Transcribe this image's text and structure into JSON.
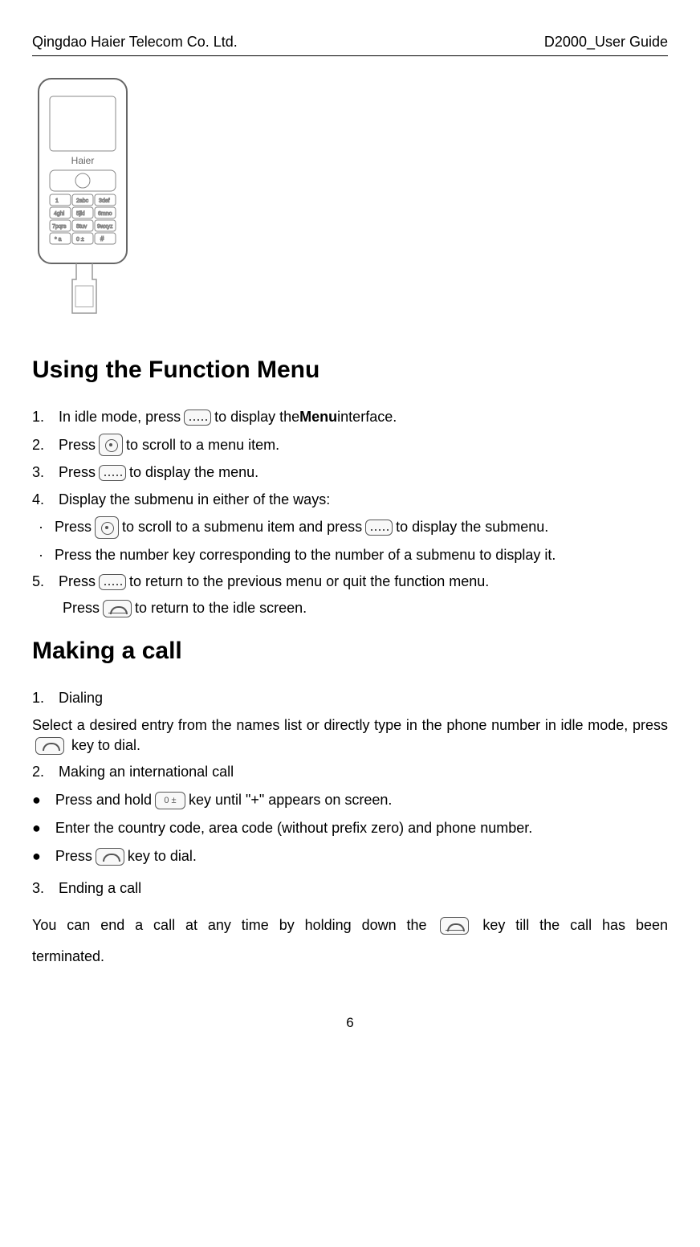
{
  "header": {
    "left": "Qingdao Haier Telecom Co. Ltd.",
    "right": "D2000_User Guide"
  },
  "section1": {
    "title": "Using the Function Menu",
    "items": [
      {
        "num": "1.",
        "pre": "In idle mode, press ",
        "post": " to display the ",
        "bold": "Menu",
        "post2": " interface."
      },
      {
        "num": "2.",
        "pre": "Press ",
        "post": " to scroll to a menu item."
      },
      {
        "num": "3.",
        "pre": "Press ",
        "post": " to display the menu."
      },
      {
        "num": "4.",
        "text": "Display the submenu in either of the ways:"
      }
    ],
    "subitems": [
      {
        "pre": "Press ",
        "mid": " to scroll to a submenu item and press ",
        "post": " to display the submenu."
      },
      {
        "text": "Press the number key corresponding to the number of a submenu to display it."
      }
    ],
    "item5": {
      "num": "5.",
      "pre": "Press  ",
      "post": " to return to the previous menu or quit the function menu.",
      "line2pre": "Press ",
      "line2post": " to return to the idle screen."
    }
  },
  "section2": {
    "title": "Making a call",
    "item1": {
      "num": "1.",
      "text": "Dialing"
    },
    "para1_pre": "Select a desired entry from the names list or directly type in the phone number in idle mode, press ",
    "para1_post": " key to dial.",
    "item2": {
      "num": "2.",
      "text": "Making an international call"
    },
    "bullets": [
      {
        "pre": "Press and hold ",
        "post": " key until \"+\" appears on screen."
      },
      {
        "text": "Enter the country code, area code (without prefix zero) and phone number."
      },
      {
        "pre": "Press ",
        "post": " key to dial."
      }
    ],
    "item3": {
      "num": "3.",
      "text": "Ending a call"
    },
    "para2_pre": "You can end a call at any time by holding down the ",
    "para2_post": " key till the call has been terminated."
  },
  "footer": {
    "page": "6"
  },
  "keylabels": {
    "zero": "0 ±"
  }
}
